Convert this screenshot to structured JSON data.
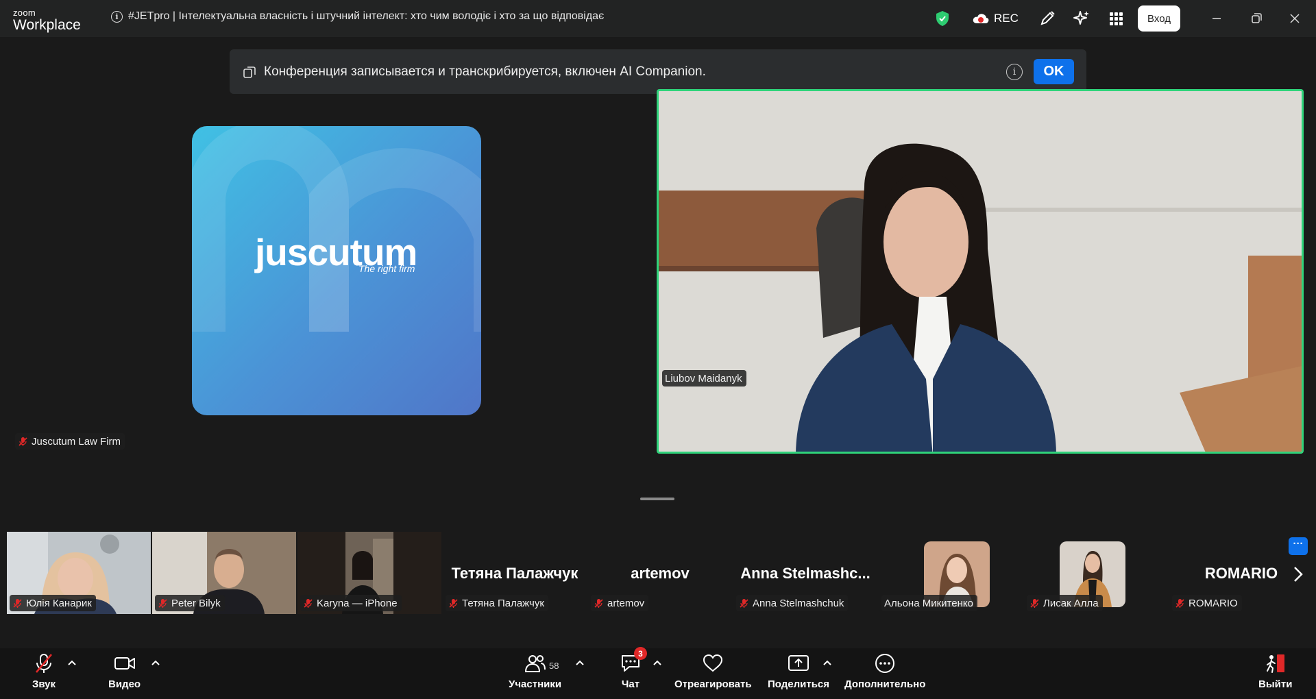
{
  "app": {
    "brand_small": "zoom",
    "brand_large": "Workplace"
  },
  "meeting": {
    "title": "#JETpro | Інтелектуальна власність і штучний інтелект: хто чим володіє і хто за що відповідає"
  },
  "titlebar": {
    "rec_label": "REC",
    "login_label": "Вход",
    "icons": [
      "shield-icon",
      "cloud-record-icon",
      "pen-icon",
      "sparkle-icon",
      "apps-grid-icon",
      "minimize-icon",
      "restore-icon",
      "close-icon"
    ]
  },
  "notice": {
    "text": "Конференция записывается и транскрибируется, включен AI Companion.",
    "ok_label": "OK"
  },
  "main_tiles": {
    "left": {
      "logo_word": "juscutum",
      "logo_tagline": "The right firm",
      "name": "Juscutum Law Firm"
    },
    "right": {
      "name": "Liubov Maidanyk"
    }
  },
  "gallery": [
    {
      "bigname": "",
      "name": "Юлія Канарик",
      "type": "video",
      "muted": true
    },
    {
      "bigname": "",
      "name": "Peter Bilyk",
      "type": "video",
      "muted": true
    },
    {
      "bigname": "",
      "name": "Karyna — iPhone",
      "type": "video",
      "muted": true
    },
    {
      "bigname": "Тетяна Палажчук",
      "name": "Тетяна Палажчук",
      "type": "name",
      "muted": true
    },
    {
      "bigname": "artemov",
      "name": "artemov",
      "type": "name",
      "muted": true
    },
    {
      "bigname": "Anna  Stelmashc...",
      "name": "Anna Stelmashchuk",
      "type": "name",
      "muted": true
    },
    {
      "bigname": "",
      "name": "Альона Микитенко",
      "type": "avatar",
      "muted": false
    },
    {
      "bigname": "",
      "name": "Лисак Алла",
      "type": "avatar",
      "muted": true
    },
    {
      "bigname": "ROMARIO",
      "name": "ROMARIO",
      "type": "name",
      "muted": true
    }
  ],
  "gallery_more": "···",
  "toolbar": {
    "audio": "Звук",
    "video": "Видео",
    "participants": "Участники",
    "participants_count": "58",
    "chat": "Чат",
    "chat_badge": "3",
    "react": "Отреагировать",
    "share": "Поделиться",
    "more": "Дополнительно",
    "leave": "Выйти"
  },
  "colors": {
    "accent": "#0e71eb",
    "active_speaker": "#2fd37a",
    "mute_red": "#e02828",
    "shield_green": "#2ecc71"
  }
}
